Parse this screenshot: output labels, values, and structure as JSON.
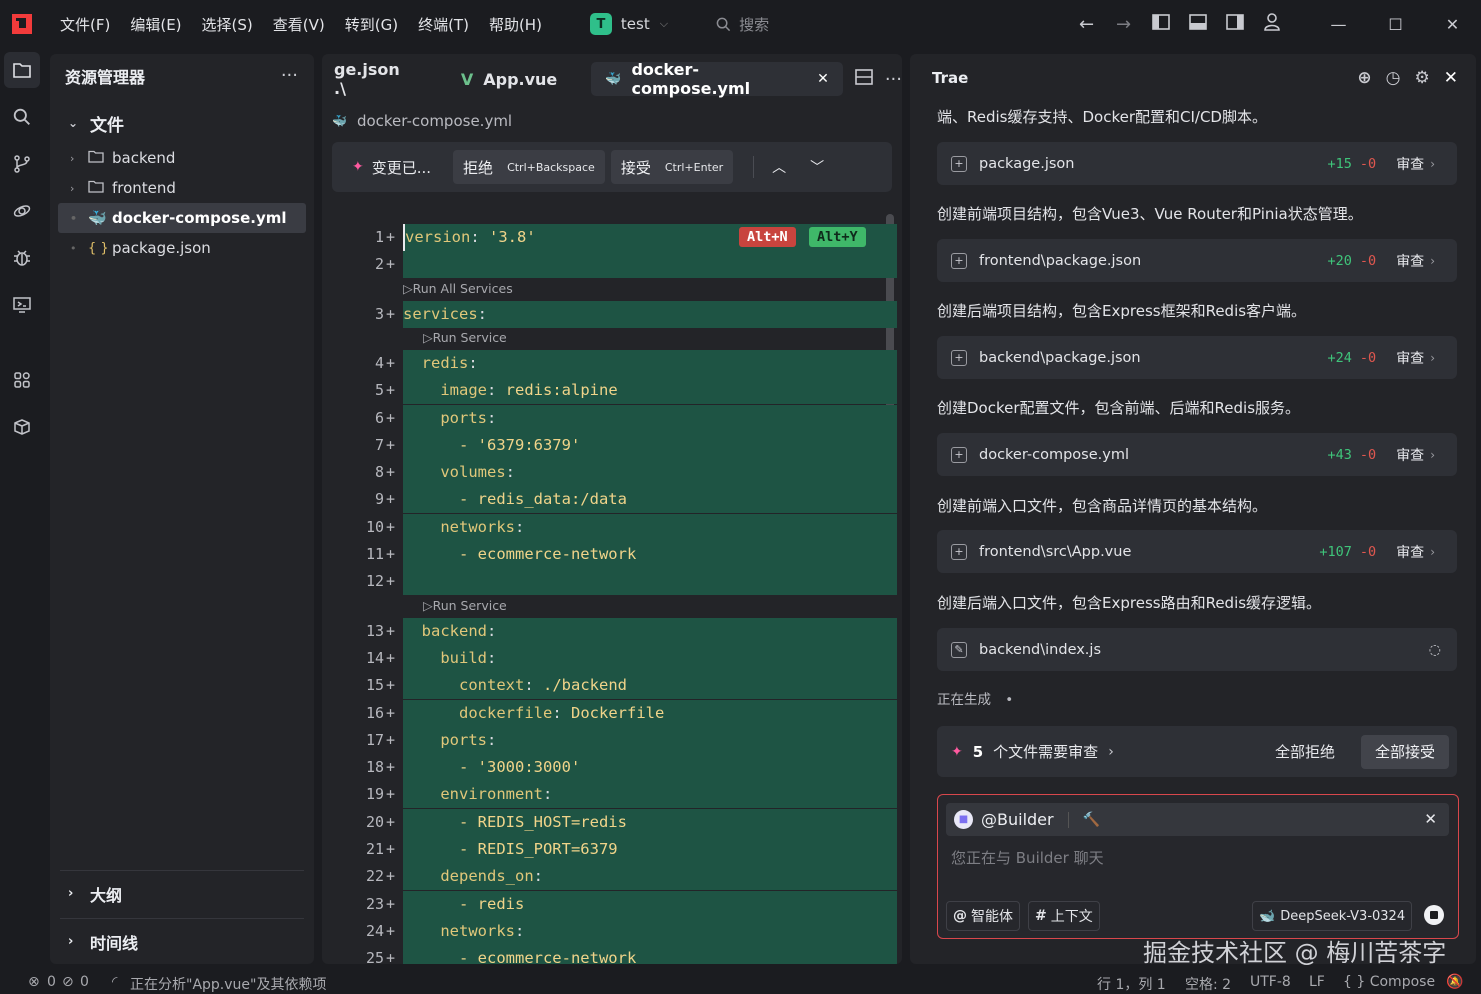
{
  "menu": [
    "文件(F)",
    "编辑(E)",
    "选择(S)",
    "查看(V)",
    "转到(G)",
    "终端(T)",
    "帮助(H)"
  ],
  "project": {
    "badge": "T",
    "name": "test"
  },
  "search_placeholder": "搜索",
  "explorer": {
    "title": "资源管理器",
    "section": "文件",
    "items": [
      {
        "label": "backend",
        "type": "folder"
      },
      {
        "label": "frontend",
        "type": "folder"
      },
      {
        "label": "docker-compose.yml",
        "type": "file",
        "selected": true
      },
      {
        "label": "package.json",
        "type": "file"
      }
    ],
    "outline": "大纲",
    "timeline": "时间线"
  },
  "editor": {
    "tabs": [
      {
        "label": "ge.json .\\"
      },
      {
        "label": "App.vue"
      },
      {
        "label": "docker-compose.yml",
        "active": true,
        "close": "✕"
      }
    ],
    "breadcrumb": "docker-compose.yml",
    "review": {
      "label": "变更已...",
      "reject": "拒绝",
      "reject_key": "Ctrl+Backspace",
      "accept": "接受",
      "accept_key": "Ctrl+Enter"
    },
    "hints": {
      "reject": "Alt+N",
      "accept": "Alt+Y"
    },
    "lens": {
      "all": "▷Run All Services",
      "one": "▷Run Service"
    },
    "lines": [
      "version: '3.8'",
      "",
      "services:",
      "  redis:",
      "    image: redis:alpine",
      "    ports:",
      "      - '6379:6379'",
      "    volumes:",
      "      - redis_data:/data",
      "    networks:",
      "      - ecommerce-network",
      "",
      "  backend:",
      "    build:",
      "      context: ./backend",
      "      dockerfile: Dockerfile",
      "    ports:",
      "      - '3000:3000'",
      "    environment:",
      "      - REDIS_HOST=redis",
      "      - REDIS_PORT=6379",
      "    depends_on:",
      "      - redis",
      "    networks:",
      "      - ecommerce-network"
    ]
  },
  "panel": {
    "title": "Trae",
    "intro": "端、Redis缓存支持、Docker配置和CI/CD脚本。",
    "files": [
      {
        "name": "package.json",
        "add": "+15",
        "del": "-0",
        "review": "审查",
        "desc": "创建前端项目结构，包含Vue3、Vue Router和Pinia状态管理。"
      },
      {
        "name": "frontend\\package.json",
        "add": "+20",
        "del": "-0",
        "review": "审查",
        "desc": "创建后端项目结构，包含Express框架和Redis客户端。"
      },
      {
        "name": "backend\\package.json",
        "add": "+24",
        "del": "-0",
        "review": "审查",
        "desc": "创建Docker配置文件，包含前端、后端和Redis服务。"
      },
      {
        "name": "docker-compose.yml",
        "add": "+43",
        "del": "-0",
        "review": "审查",
        "desc": "创建前端入口文件，包含商品详情页的基本结构。"
      },
      {
        "name": "frontend\\src\\App.vue",
        "add": "+107",
        "del": "-0",
        "review": "审查",
        "desc": "创建后端入口文件，包含Express路由和Redis缓存逻辑。"
      },
      {
        "name": "backend\\index.js",
        "pending": true
      }
    ],
    "generating": "正在生成",
    "summary": {
      "count": "5",
      "text": "个文件需要审查",
      "reject_all": "全部拒绝",
      "accept_all": "全部接受"
    },
    "chat": {
      "agent": "@Builder",
      "placeholder": "您正在与 Builder 聊天",
      "chip_agent": "智能体",
      "chip_context": "上下文",
      "model": "DeepSeek-V3-0324"
    }
  },
  "watermark": "掘金技术社区 @ 梅川苦茶字",
  "status": {
    "errors": "0",
    "warnings": "0",
    "task": "正在分析\"App.vue\"及其依赖项",
    "position": "行 1，列 1",
    "indent": "空格: 2",
    "encoding": "UTF-8",
    "eol": "LF",
    "language": "{ } Compose"
  }
}
